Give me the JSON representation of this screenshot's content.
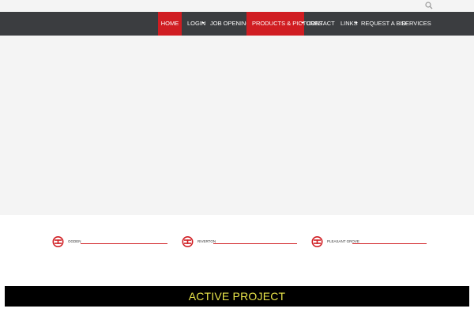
{
  "topbar": {
    "search_icon": "search-icon"
  },
  "nav": {
    "items": [
      {
        "label": "Home",
        "active": true,
        "dropdown": false
      },
      {
        "label": "Login",
        "active": false,
        "dropdown": true
      },
      {
        "label": "Job Openings",
        "active": false,
        "dropdown": false
      },
      {
        "label": "Products & Pictures",
        "active": true,
        "dropdown": true
      },
      {
        "label": "Contact",
        "active": false,
        "dropdown": false
      },
      {
        "label": "Links",
        "active": false,
        "dropdown": true
      },
      {
        "label": "Request A Bid",
        "active": false,
        "dropdown": false
      },
      {
        "label": "Services",
        "active": false,
        "dropdown": false
      }
    ]
  },
  "locations": [
    {
      "name": "Ogden"
    },
    {
      "name": "Riverton"
    },
    {
      "name": "Pleasant Grove"
    }
  ],
  "active_project": {
    "title": "ACTIVE PROJECT"
  },
  "colors": {
    "nav_bg": "#3b3d40",
    "accent_red": "#d01d22",
    "active_project_text": "#e9e44a",
    "hero_bg": "#f4f4f4"
  }
}
